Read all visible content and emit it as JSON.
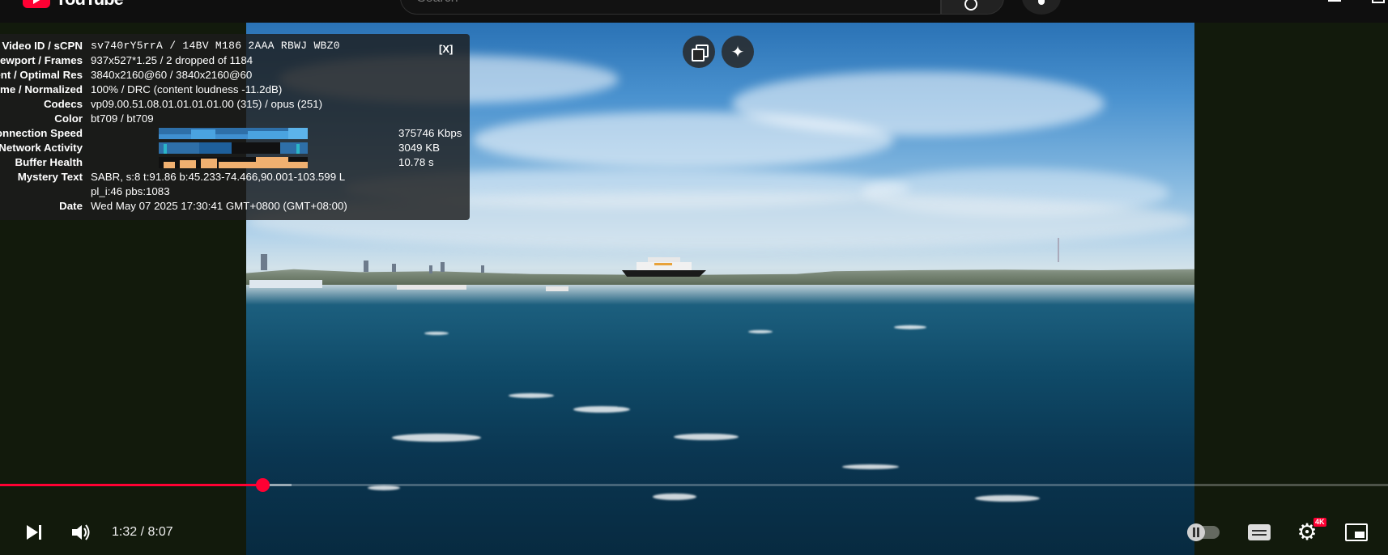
{
  "header": {
    "logo_text": "YouTube",
    "search_placeholder": "Search"
  },
  "nerd_stats": {
    "close_label": "[X]",
    "rows": [
      {
        "label": "Video ID / sCPN",
        "value": "sv740rY5rrA / 14BV M186 2AAA RBWJ WBZ0"
      },
      {
        "label": "Viewport / Frames",
        "value": "937x527*1.25 / 2 dropped of 1184"
      },
      {
        "label": "Current / Optimal Res",
        "value": "3840x2160@60 / 3840x2160@60"
      },
      {
        "label": "Volume / Normalized",
        "value": "100% / DRC (content loudness -11.2dB)"
      },
      {
        "label": "Codecs",
        "value": "vp09.00.51.08.01.01.01.01.00 (315) / opus (251)"
      },
      {
        "label": "Color",
        "value": "bt709 / bt709"
      },
      {
        "label": "Connection Speed",
        "value": "375746 Kbps"
      },
      {
        "label": "Network Activity",
        "value": "3049 KB"
      },
      {
        "label": "Buffer Health",
        "value": "10.78 s"
      },
      {
        "label": "Mystery Text",
        "value": "SABR, s:8 t:91.86 b:45.233-74.466,90.001-103.599 L",
        "value2": "pl_i:46 pbs:1083"
      },
      {
        "label": "Date",
        "value": "Wed May 07 2025 17:30:41 GMT+0800 (GMT+08:00)"
      }
    ],
    "graph_colors": {
      "connection": "#4a9fd8",
      "network": "#2bb5c8",
      "buffer": "#f0b070"
    }
  },
  "player": {
    "time_display": "1:32 / 8:07",
    "progress_played_fraction": 0.189,
    "progress_loaded_fraction": 0.21,
    "quality_badge": "4K",
    "accent_color": "#ff0033",
    "icons": [
      "copy-link-icon",
      "sparkle-icon",
      "play-next-icon",
      "volume-icon",
      "autoplay-toggle-icon",
      "subtitles-icon",
      "settings-gear-icon",
      "miniplayer-icon"
    ]
  }
}
